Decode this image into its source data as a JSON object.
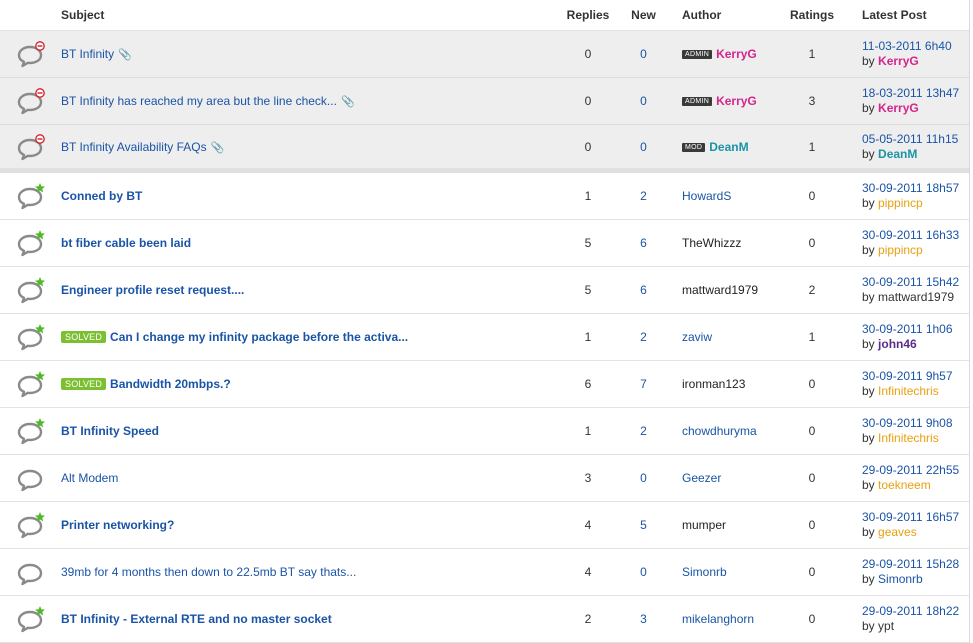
{
  "headers": {
    "subject": "Subject",
    "replies": "Replies",
    "new": "New",
    "author": "Author",
    "ratings": "Ratings",
    "latest": "Latest Post"
  },
  "by_label": "by",
  "threads": [
    {
      "subject": "BT Infinity",
      "attach": true,
      "solved": false,
      "bold": false,
      "pinned": true,
      "status": "locked",
      "replies": "0",
      "new": "0",
      "author": "KerryG",
      "author_badge": "ADMIN",
      "author_style": "admin",
      "ratings": "1",
      "last_date": "11-03-2011 6h40",
      "last_by": "KerryG",
      "last_by_style": "admin"
    },
    {
      "subject": "BT Infinity has reached my area but the line check...",
      "attach": true,
      "solved": false,
      "bold": false,
      "pinned": true,
      "status": "locked",
      "replies": "0",
      "new": "0",
      "author": "KerryG",
      "author_badge": "ADMIN",
      "author_style": "admin",
      "ratings": "3",
      "last_date": "18-03-2011 13h47",
      "last_by": "KerryG",
      "last_by_style": "admin"
    },
    {
      "subject": "BT Infinity Availability FAQs",
      "attach": true,
      "solved": false,
      "bold": false,
      "pinned": true,
      "status": "locked",
      "replies": "0",
      "new": "0",
      "author": "DeanM",
      "author_badge": "MOD",
      "author_style": "mod",
      "ratings": "1",
      "last_date": "05-05-2011 11h15",
      "last_by": "DeanM",
      "last_by_style": "mod"
    },
    {
      "subject": "Conned by BT",
      "attach": false,
      "solved": false,
      "bold": true,
      "pinned": false,
      "status": "new",
      "replies": "1",
      "new": "2",
      "author": "HowardS",
      "author_badge": "",
      "author_style": "link",
      "ratings": "0",
      "last_date": "30-09-2011 18h57",
      "last_by": "pippincp",
      "last_by_style": "orange"
    },
    {
      "subject": "bt fiber cable been laid",
      "attach": false,
      "solved": false,
      "bold": true,
      "pinned": false,
      "status": "new",
      "replies": "5",
      "new": "6",
      "author": "TheWhizzz",
      "author_badge": "",
      "author_style": "plain",
      "ratings": "0",
      "last_date": "30-09-2011 16h33",
      "last_by": "pippincp",
      "last_by_style": "orange"
    },
    {
      "subject": "Engineer profile reset request....",
      "attach": false,
      "solved": false,
      "bold": true,
      "pinned": false,
      "status": "new",
      "replies": "5",
      "new": "6",
      "author": "mattward1979",
      "author_badge": "",
      "author_style": "plain",
      "ratings": "2",
      "last_date": "30-09-2011 15h42",
      "last_by": "mattward1979",
      "last_by_style": "plain"
    },
    {
      "subject": "Can I change my infinity package before the activa...",
      "attach": false,
      "solved": true,
      "bold": true,
      "pinned": false,
      "status": "new",
      "replies": "1",
      "new": "2",
      "author": "zaviw",
      "author_badge": "",
      "author_style": "link",
      "ratings": "1",
      "last_date": "30-09-2011 1h06",
      "last_by": "john46",
      "last_by_style": "purple"
    },
    {
      "subject": "Bandwidth 20mbps.?",
      "attach": false,
      "solved": true,
      "bold": true,
      "pinned": false,
      "status": "new",
      "replies": "6",
      "new": "7",
      "author": "ironman123",
      "author_badge": "",
      "author_style": "plain",
      "ratings": "0",
      "last_date": "30-09-2011 9h57",
      "last_by": "Infinitechris",
      "last_by_style": "orange"
    },
    {
      "subject": "BT Infinity Speed",
      "attach": false,
      "solved": false,
      "bold": true,
      "pinned": false,
      "status": "new",
      "replies": "1",
      "new": "2",
      "author": "chowdhuryma",
      "author_badge": "",
      "author_style": "link",
      "ratings": "0",
      "last_date": "30-09-2011 9h08",
      "last_by": "Infinitechris",
      "last_by_style": "orange"
    },
    {
      "subject": "Alt Modem",
      "attach": false,
      "solved": false,
      "bold": false,
      "pinned": false,
      "status": "read",
      "replies": "3",
      "new": "0",
      "author": "Geezer",
      "author_badge": "",
      "author_style": "link",
      "ratings": "0",
      "last_date": "29-09-2011 22h55",
      "last_by": "toekneem",
      "last_by_style": "orange"
    },
    {
      "subject": "Printer networking?",
      "attach": false,
      "solved": false,
      "bold": true,
      "pinned": false,
      "status": "new",
      "replies": "4",
      "new": "5",
      "author": "mumper",
      "author_badge": "",
      "author_style": "plain",
      "ratings": "0",
      "last_date": "30-09-2011 16h57",
      "last_by": "geaves",
      "last_by_style": "orange"
    },
    {
      "subject": "39mb for 4 months then down to 22.5mb BT say thats...",
      "attach": false,
      "solved": false,
      "bold": false,
      "pinned": false,
      "status": "read",
      "replies": "4",
      "new": "0",
      "author": "Simonrb",
      "author_badge": "",
      "author_style": "link",
      "ratings": "0",
      "last_date": "29-09-2011 15h28",
      "last_by": "Simonrb",
      "last_by_style": "blue"
    },
    {
      "subject": "BT Infinity - External RTE and no master socket",
      "attach": false,
      "solved": false,
      "bold": true,
      "pinned": false,
      "status": "new",
      "replies": "2",
      "new": "3",
      "author": "mikelanghorn",
      "author_badge": "",
      "author_style": "link",
      "ratings": "0",
      "last_date": "29-09-2011 18h22",
      "last_by": "ypt",
      "last_by_style": "plain"
    }
  ],
  "solved_label": "SOLVED",
  "icons": {
    "thread": "speech-bubble-icon",
    "locked": "no-entry-icon",
    "new": "green-star-icon",
    "attachment": "paperclip-icon"
  },
  "colors": {
    "link": "#1a54a6",
    "admin": "#d4268c",
    "mod": "#1b94a5",
    "orange": "#e8a010",
    "solved": "#7cbf31"
  }
}
